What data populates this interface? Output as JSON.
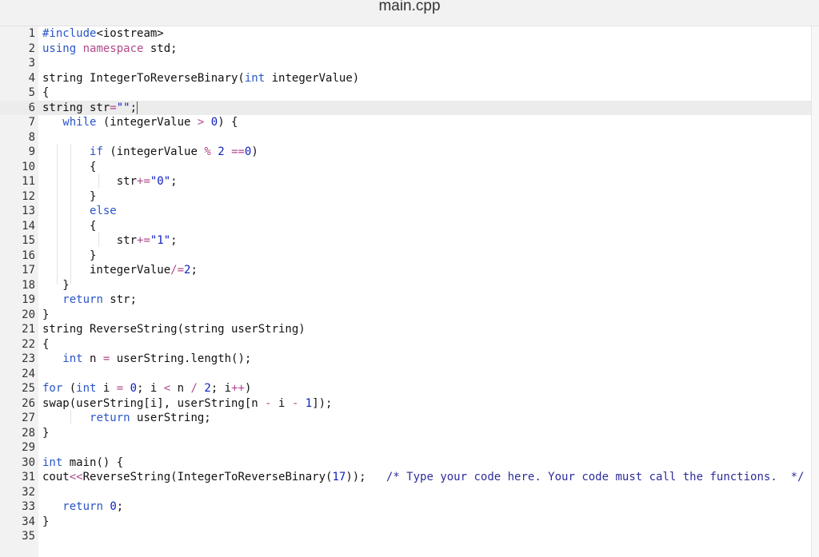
{
  "window": {
    "title": "main.cpp"
  },
  "editor": {
    "active_line": 6,
    "lines": [
      {
        "n": "1",
        "tokens": [
          [
            "kw",
            "#include"
          ],
          [
            "",
            "<iostream>"
          ]
        ]
      },
      {
        "n": "2",
        "tokens": [
          [
            "kw",
            "using"
          ],
          [
            "",
            " "
          ],
          [
            "op",
            "namespace"
          ],
          [
            "",
            " std;"
          ]
        ]
      },
      {
        "n": "3",
        "tokens": []
      },
      {
        "n": "4",
        "tokens": [
          [
            "",
            "string IntegerToReverseBinary("
          ],
          [
            "kw",
            "int"
          ],
          [
            "",
            " integerValue)"
          ]
        ]
      },
      {
        "n": "5",
        "tokens": [
          [
            "",
            "{"
          ]
        ]
      },
      {
        "n": "6",
        "tokens": [
          [
            "",
            "string str"
          ],
          [
            "op",
            "="
          ],
          [
            "str",
            "\"\""
          ],
          [
            "",
            ";"
          ]
        ],
        "cursor": true
      },
      {
        "n": "7",
        "tokens": [
          [
            "",
            "   "
          ],
          [
            "kw",
            "while"
          ],
          [
            "",
            " (integerValue "
          ],
          [
            "op",
            ">"
          ],
          [
            "",
            " "
          ],
          [
            "num",
            "0"
          ],
          [
            "",
            ") {"
          ]
        ]
      },
      {
        "n": "8",
        "tokens": []
      },
      {
        "n": "9",
        "tokens": [
          [
            "",
            "       "
          ],
          [
            "kw",
            "if"
          ],
          [
            "",
            " (integerValue "
          ],
          [
            "op",
            "%"
          ],
          [
            "",
            " "
          ],
          [
            "num",
            "2"
          ],
          [
            "",
            " "
          ],
          [
            "op",
            "=="
          ],
          [
            "num",
            "0"
          ],
          [
            "",
            ")"
          ]
        ]
      },
      {
        "n": "10",
        "tokens": [
          [
            "",
            "       {"
          ]
        ]
      },
      {
        "n": "11",
        "tokens": [
          [
            "",
            "           str"
          ],
          [
            "op",
            "+="
          ],
          [
            "str",
            "\"0\""
          ],
          [
            "",
            ";"
          ]
        ]
      },
      {
        "n": "12",
        "tokens": [
          [
            "",
            "       }"
          ]
        ]
      },
      {
        "n": "13",
        "tokens": [
          [
            "",
            "       "
          ],
          [
            "kw",
            "else"
          ]
        ]
      },
      {
        "n": "14",
        "tokens": [
          [
            "",
            "       {"
          ]
        ]
      },
      {
        "n": "15",
        "tokens": [
          [
            "",
            "           str"
          ],
          [
            "op",
            "+="
          ],
          [
            "str",
            "\"1\""
          ],
          [
            "",
            ";"
          ]
        ]
      },
      {
        "n": "16",
        "tokens": [
          [
            "",
            "       }"
          ]
        ]
      },
      {
        "n": "17",
        "tokens": [
          [
            "",
            "       integerValue"
          ],
          [
            "op",
            "/="
          ],
          [
            "num",
            "2"
          ],
          [
            "",
            ";"
          ]
        ]
      },
      {
        "n": "18",
        "tokens": [
          [
            "",
            "   }"
          ]
        ]
      },
      {
        "n": "19",
        "tokens": [
          [
            "",
            "   "
          ],
          [
            "kw",
            "return"
          ],
          [
            "",
            " str;"
          ]
        ]
      },
      {
        "n": "20",
        "tokens": [
          [
            "",
            "}"
          ]
        ]
      },
      {
        "n": "21",
        "tokens": [
          [
            "",
            "string ReverseString(string userString)"
          ]
        ]
      },
      {
        "n": "22",
        "tokens": [
          [
            "",
            "{"
          ]
        ]
      },
      {
        "n": "23",
        "tokens": [
          [
            "",
            "   "
          ],
          [
            "kw",
            "int"
          ],
          [
            "",
            " n "
          ],
          [
            "op",
            "="
          ],
          [
            "",
            " userString.length();"
          ]
        ]
      },
      {
        "n": "24",
        "tokens": []
      },
      {
        "n": "25",
        "tokens": [
          [
            "kw",
            "for"
          ],
          [
            "",
            " ("
          ],
          [
            "kw",
            "int"
          ],
          [
            "",
            " i "
          ],
          [
            "op",
            "="
          ],
          [
            "",
            " "
          ],
          [
            "num",
            "0"
          ],
          [
            "",
            "; i "
          ],
          [
            "op",
            "<"
          ],
          [
            "",
            " n "
          ],
          [
            "op",
            "/"
          ],
          [
            "",
            " "
          ],
          [
            "num",
            "2"
          ],
          [
            "",
            "; i"
          ],
          [
            "op",
            "++"
          ],
          [
            "",
            ")"
          ]
        ]
      },
      {
        "n": "26",
        "tokens": [
          [
            "",
            "swap(userString[i], userString[n "
          ],
          [
            "op",
            "-"
          ],
          [
            "",
            " i "
          ],
          [
            "op",
            "-"
          ],
          [
            "",
            " "
          ],
          [
            "num",
            "1"
          ],
          [
            "",
            "]);"
          ]
        ]
      },
      {
        "n": "27",
        "tokens": [
          [
            "",
            "       "
          ],
          [
            "kw",
            "return"
          ],
          [
            "",
            " userString;"
          ]
        ]
      },
      {
        "n": "28",
        "tokens": [
          [
            "",
            "}"
          ]
        ]
      },
      {
        "n": "29",
        "tokens": []
      },
      {
        "n": "30",
        "tokens": [
          [
            "kw",
            "int"
          ],
          [
            "",
            " main() {"
          ]
        ]
      },
      {
        "n": "31",
        "tokens": [
          [
            "",
            "cout"
          ],
          [
            "op",
            "<<"
          ],
          [
            "",
            "ReverseString(IntegerToReverseBinary("
          ],
          [
            "num",
            "17"
          ],
          [
            "",
            "));   "
          ],
          [
            "com",
            "/* Type your code here. Your code must call the functions.  */"
          ]
        ]
      },
      {
        "n": "32",
        "tokens": []
      },
      {
        "n": "33",
        "tokens": [
          [
            "",
            "   "
          ],
          [
            "kw",
            "return"
          ],
          [
            "",
            " "
          ],
          [
            "num",
            "0"
          ],
          [
            "",
            ";"
          ]
        ]
      },
      {
        "n": "34",
        "tokens": [
          [
            "",
            "}"
          ]
        ]
      },
      {
        "n": "35",
        "tokens": []
      }
    ]
  }
}
